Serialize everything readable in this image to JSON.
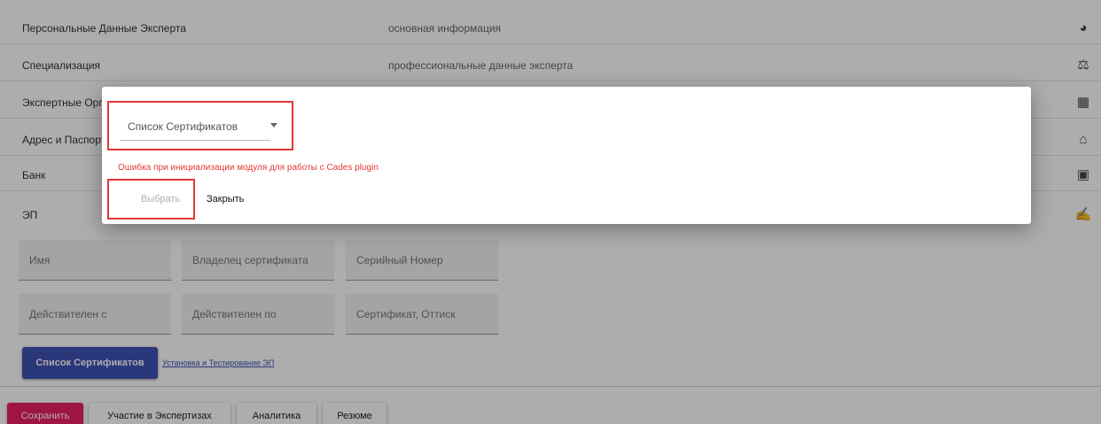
{
  "sections": [
    {
      "title": "Персональные Данные Эксперта",
      "desc": "основная информация",
      "icon": "account-circle-icon",
      "glyph": "◕"
    },
    {
      "title": "Специализация",
      "desc": "профессиональные данные эксперта",
      "icon": "gavel-icon",
      "glyph": "⚖"
    },
    {
      "title": "Экспертные Организации",
      "desc": "",
      "icon": "business-icon",
      "glyph": "▦"
    },
    {
      "title": "Адрес и Паспорт",
      "desc": "",
      "icon": "home-icon",
      "glyph": "⌂"
    },
    {
      "title": "Банк",
      "desc": "",
      "icon": "contact-card-icon",
      "glyph": "▣"
    },
    {
      "title": "ЭП",
      "desc": "",
      "icon": "signature-hand-icon",
      "glyph": "✍"
    }
  ],
  "cert_fields": [
    "Имя",
    "Владелец сертификата",
    "Серийный Номер",
    "Действителен с",
    "Действителен по",
    "Сертификат, Оттиск"
  ],
  "cert_list_button": "Список Сертификатов",
  "install_link": "Установка и Тестирование ЭП",
  "bottom_tabs": {
    "save": "Сохранить",
    "participation": "Участие в Экспертизах",
    "analytics": "Аналитика",
    "resume": "Резюме"
  },
  "dialog": {
    "select_label": "Список Сертификатов",
    "error": "Ошибка при инициализации модуля для работы с Cades plugin",
    "choose_button": "Выбрать",
    "close_button": "Закрыть"
  },
  "colors": {
    "primary": "#3f51b5",
    "save": "#e91e63",
    "error": "#e53935",
    "highlight": "#e53935"
  }
}
